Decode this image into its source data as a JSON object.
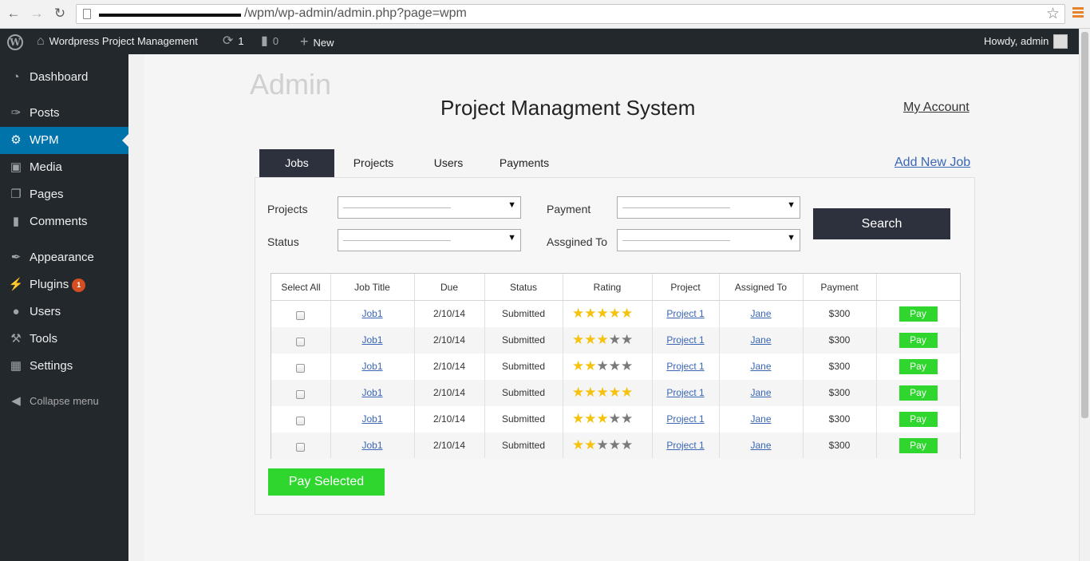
{
  "browser": {
    "url": "/wpm/wp-admin/admin.php?page=wpm"
  },
  "adminbar": {
    "site_name": "Wordpress Project Management",
    "updates_count": "1",
    "comments_count": "0",
    "new_label": "New",
    "greeting": "Howdy, admin"
  },
  "sidebar": {
    "items": [
      {
        "label": "Dashboard",
        "icon": "dashboard-icon"
      },
      {
        "label": "Posts",
        "icon": "pin-icon"
      },
      {
        "label": "WPM",
        "icon": "gear-icon"
      },
      {
        "label": "Media",
        "icon": "media-icon"
      },
      {
        "label": "Pages",
        "icon": "pages-icon"
      },
      {
        "label": "Comments",
        "icon": "comment-icon"
      },
      {
        "label": "Appearance",
        "icon": "brush-icon"
      },
      {
        "label": "Plugins",
        "icon": "plug-icon",
        "badge": "1"
      },
      {
        "label": "Users",
        "icon": "user-icon"
      },
      {
        "label": "Tools",
        "icon": "wrench-icon"
      },
      {
        "label": "Settings",
        "icon": "settings-icon"
      },
      {
        "label": "Collapse menu",
        "icon": "collapse-icon"
      }
    ]
  },
  "page": {
    "admin_title": "Admin",
    "system_title": "Project Managment System",
    "my_account": "My Account",
    "add_new_job": "Add New Job"
  },
  "tabs": [
    {
      "label": "Jobs",
      "active": true
    },
    {
      "label": "Projects"
    },
    {
      "label": "Users"
    },
    {
      "label": "Payments"
    }
  ],
  "filters": {
    "projects_label": "Projects",
    "payment_label": "Payment",
    "status_label": "Status",
    "assigned_label": "Assgined To",
    "search_label": "Search"
  },
  "table": {
    "headers": [
      "Select All",
      "Job Title",
      "Due",
      "Status",
      "Rating",
      "Project",
      "Assigned To",
      "Payment",
      ""
    ],
    "rows": [
      {
        "job": "Job1",
        "due": "2/10/14",
        "status": "Submitted",
        "rating": 5,
        "project": "Project 1",
        "assigned": "Jane",
        "payment": "$300",
        "action": "Pay"
      },
      {
        "job": "Job1",
        "due": "2/10/14",
        "status": "Submitted",
        "rating": 3,
        "project": "Project 1",
        "assigned": "Jane",
        "payment": "$300",
        "action": "Pay"
      },
      {
        "job": "Job1",
        "due": "2/10/14",
        "status": "Submitted",
        "rating": 2,
        "project": "Project 1",
        "assigned": "Jane",
        "payment": "$300",
        "action": "Pay"
      },
      {
        "job": "Job1",
        "due": "2/10/14",
        "status": "Submitted",
        "rating": 5,
        "project": "Project 1",
        "assigned": "Jane",
        "payment": "$300",
        "action": "Pay"
      },
      {
        "job": "Job1",
        "due": "2/10/14",
        "status": "Submitted",
        "rating": 3,
        "project": "Project 1",
        "assigned": "Jane",
        "payment": "$300",
        "action": "Pay"
      },
      {
        "job": "Job1",
        "due": "2/10/14",
        "status": "Submitted",
        "rating": 2,
        "project": "Project 1",
        "assigned": "Jane",
        "payment": "$300",
        "action": "Pay"
      }
    ],
    "max_rating": 5
  },
  "pay_selected": "Pay Selected",
  "colors": {
    "admin_dark": "#23282d",
    "wp_blue": "#0073aa",
    "navy_button": "#2d313e",
    "pay_green": "#2ed62e",
    "star_gold": "#f5c20c",
    "badge_orange": "#d54e21"
  }
}
